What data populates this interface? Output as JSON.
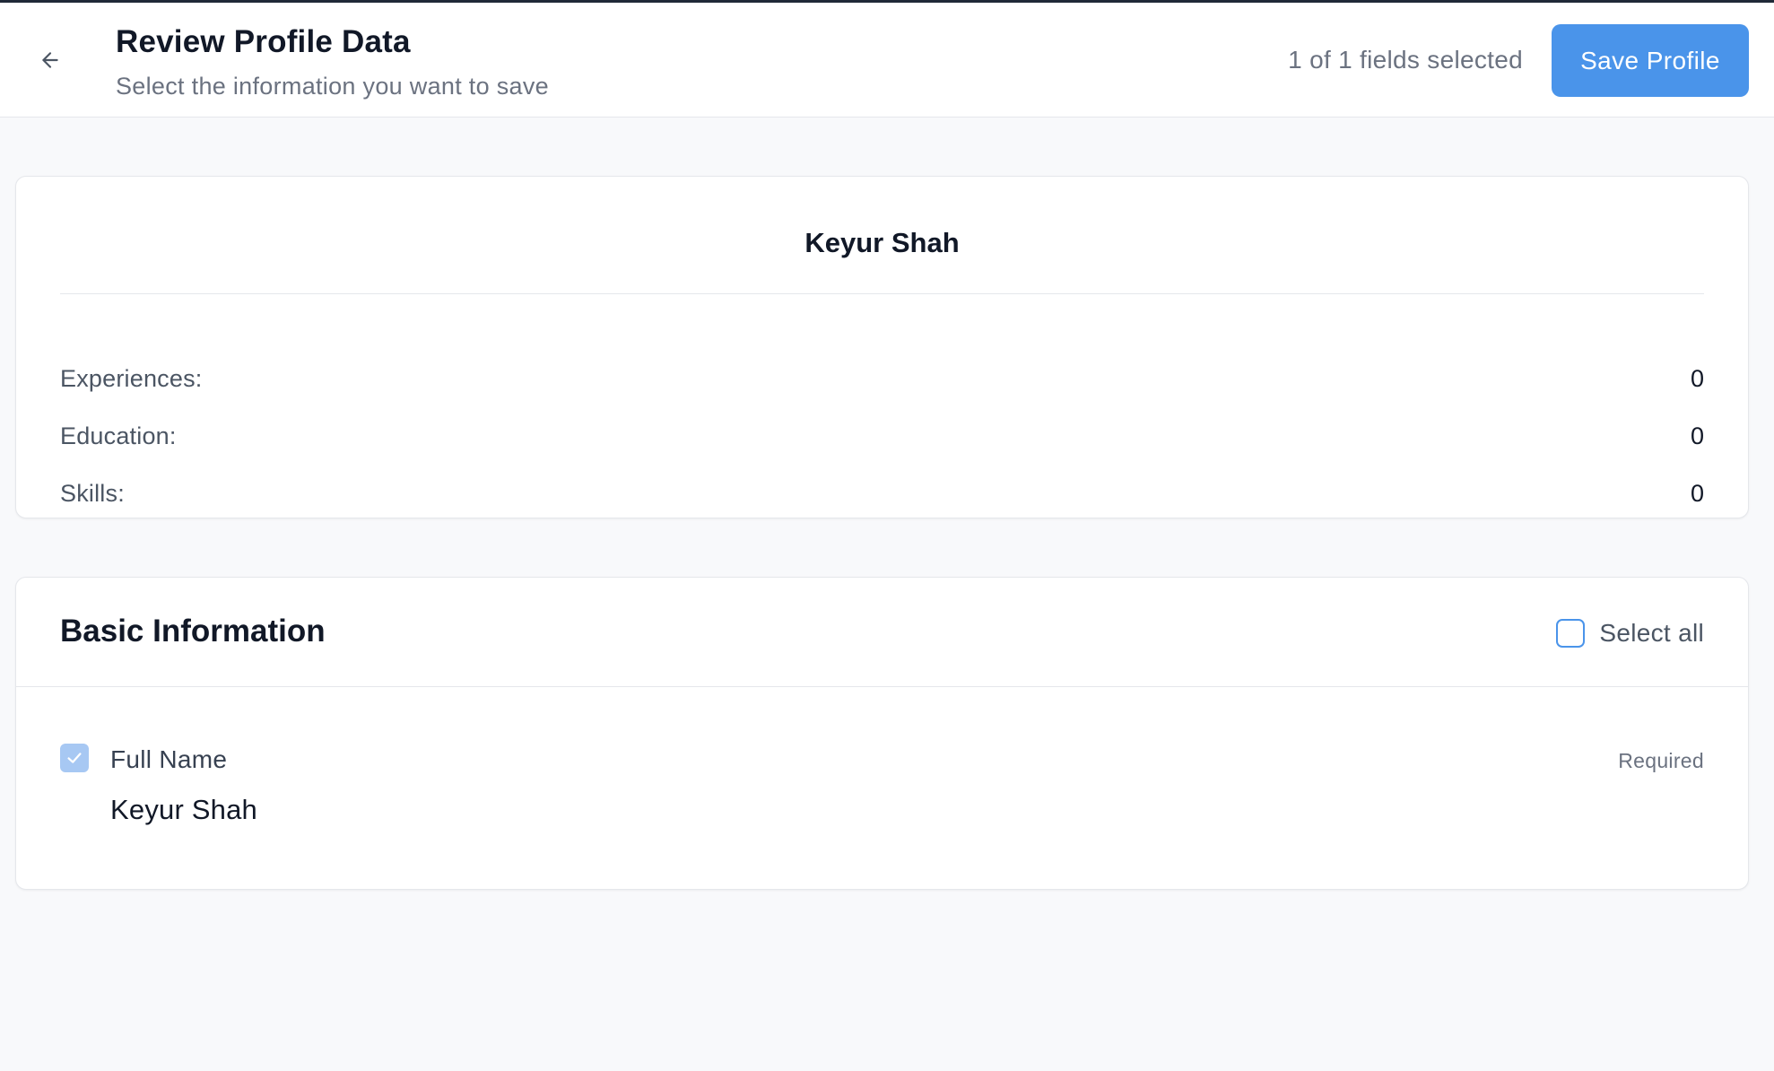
{
  "header": {
    "title": "Review Profile Data",
    "subtitle": "Select the information you want to save",
    "selection_count": "1 of 1 fields selected",
    "save_label": "Save Profile",
    "back_icon": "arrow-left-icon"
  },
  "summary": {
    "name": "Keyur Shah",
    "stats": [
      {
        "label": "Experiences:",
        "value": "0"
      },
      {
        "label": "Education:",
        "value": "0"
      },
      {
        "label": "Skills:",
        "value": "0"
      }
    ]
  },
  "basic_information": {
    "title": "Basic Information",
    "select_all_label": "Select all",
    "select_all_checked": false,
    "fields": [
      {
        "label": "Full Name",
        "value": "Keyur Shah",
        "badge": "Required",
        "checked": true
      }
    ]
  },
  "colors": {
    "accent": "#4a94ea",
    "checked_disabled": "#a7c8f3",
    "background": "#f8f9fb"
  }
}
